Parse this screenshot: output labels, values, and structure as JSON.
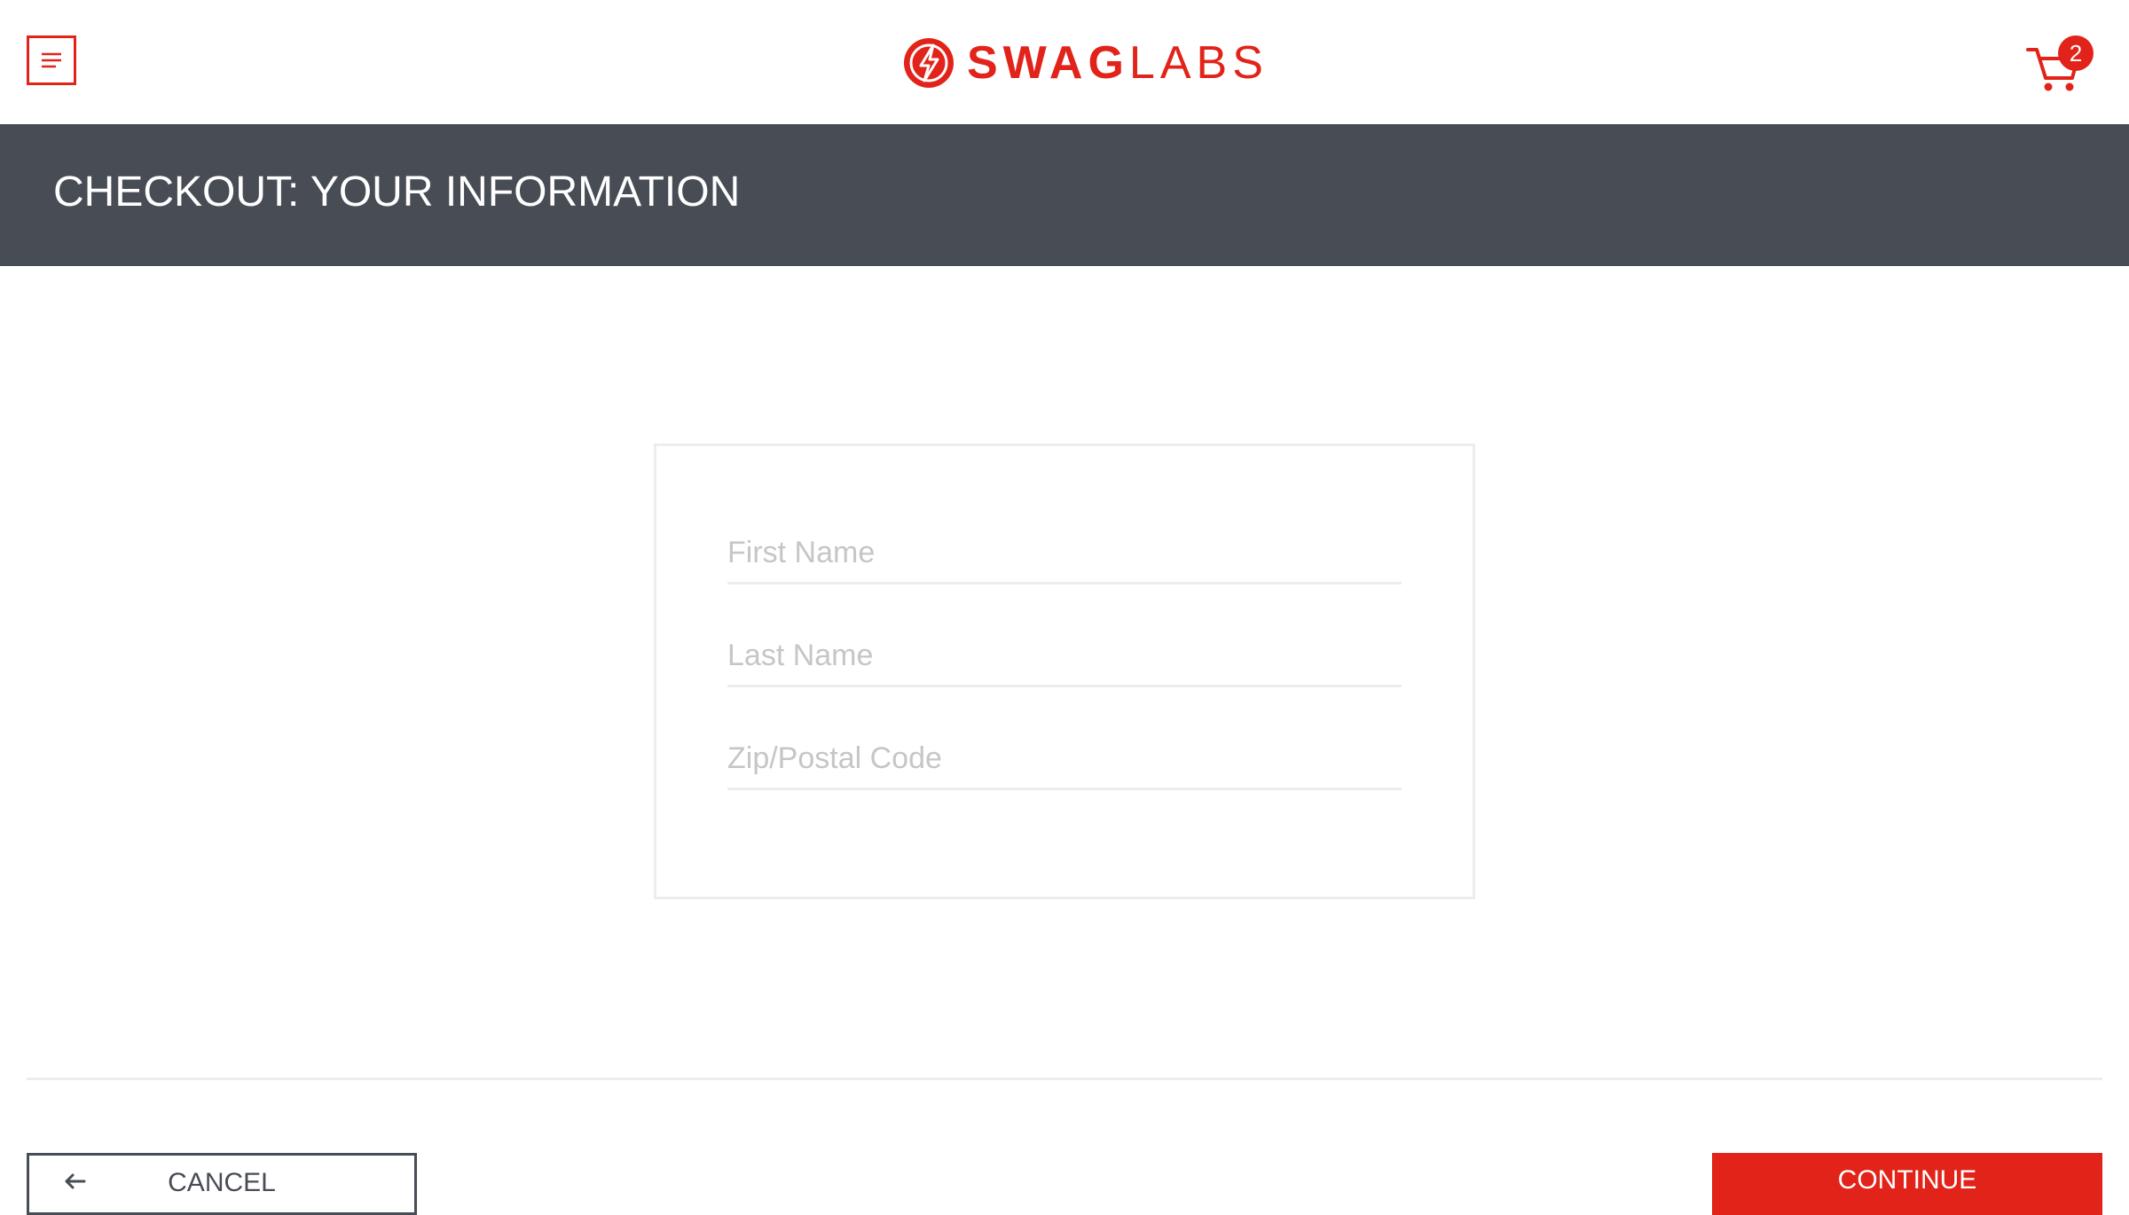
{
  "header": {
    "menu_icon": "hamburger-menu-icon",
    "logo_icon": "swag-labs-bolt-icon",
    "brand_bold": "SWAG",
    "brand_light": "LABS",
    "cart_icon": "shopping-cart-icon",
    "cart_count": "2"
  },
  "subheader": {
    "title": "CHECKOUT: YOUR INFORMATION"
  },
  "form": {
    "first_name": {
      "value": "",
      "placeholder": "First Name"
    },
    "last_name": {
      "value": "",
      "placeholder": "Last Name"
    },
    "postal_code": {
      "value": "",
      "placeholder": "Zip/Postal Code"
    }
  },
  "footer": {
    "cancel_label": "CANCEL",
    "cancel_icon": "arrow-left-icon",
    "continue_label": "CONTINUE"
  },
  "colors": {
    "accent": "#e2231a",
    "subheader_bg": "#474c55",
    "border": "#ededed",
    "placeholder": "#c6c6c6"
  }
}
